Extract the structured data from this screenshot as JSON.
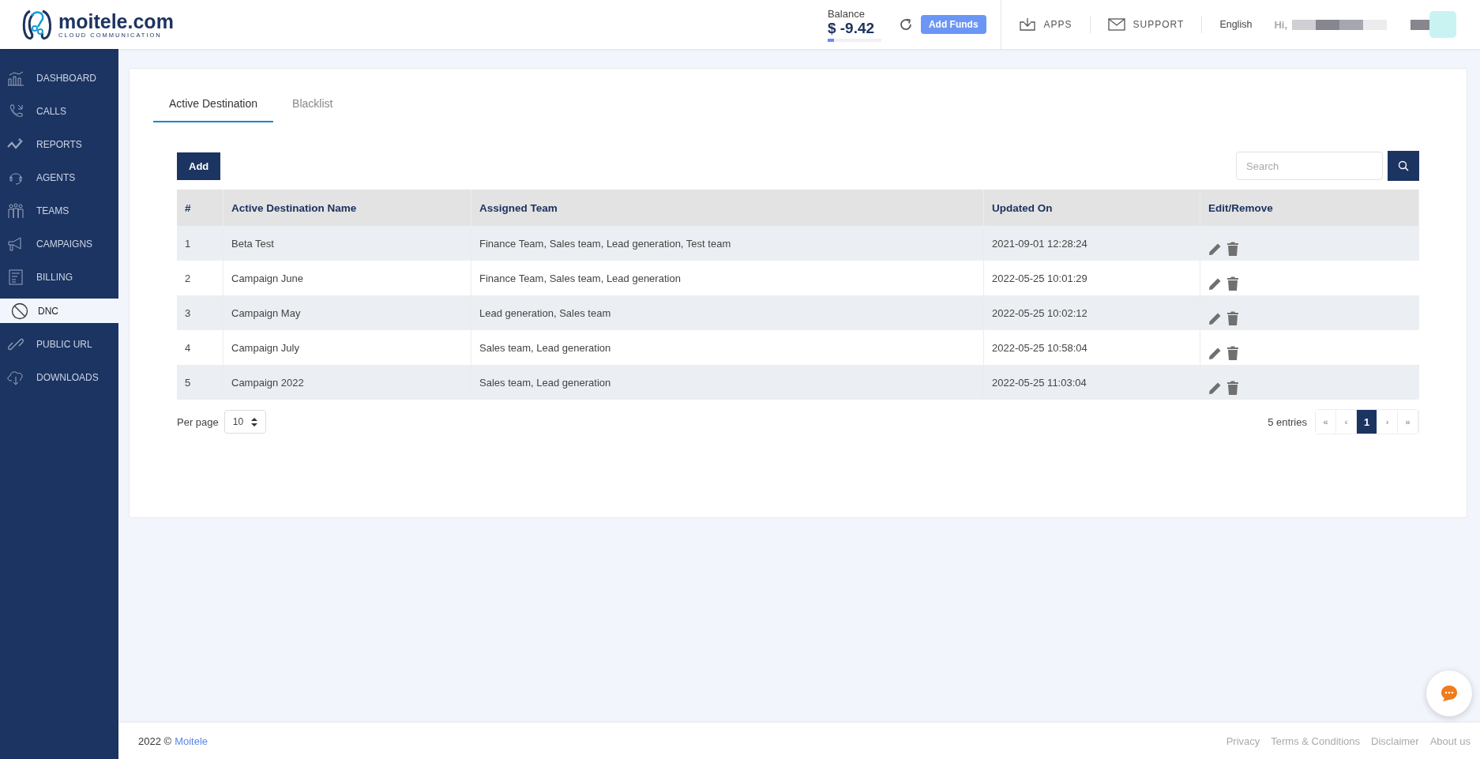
{
  "header": {
    "logo": {
      "name": "moitele.com",
      "tagline": "CLOUD COMMUNICATION"
    },
    "balance": {
      "label": "Balance",
      "amount": "$ -9.42",
      "level": 0.12
    },
    "add_funds": "Add Funds",
    "links": [
      "APPS",
      "SUPPORT"
    ],
    "language": "English",
    "greeting": "Hi,"
  },
  "sidebar": {
    "items": [
      {
        "label": "DASHBOARD",
        "selected": false
      },
      {
        "label": "CALLS",
        "selected": false
      },
      {
        "label": "REPORTS",
        "selected": false
      },
      {
        "label": "AGENTS",
        "selected": false
      },
      {
        "label": "TEAMS",
        "selected": false
      },
      {
        "label": "CAMPAIGNS",
        "selected": false
      },
      {
        "label": "BILLING",
        "selected": false
      },
      {
        "label": "DNC",
        "selected": true
      },
      {
        "label": "PUBLIC URL",
        "selected": false
      },
      {
        "label": "DOWNLOADS",
        "selected": false
      }
    ]
  },
  "tabs": [
    {
      "label": "Active Destination",
      "selected": true
    },
    {
      "label": "Blacklist",
      "selected": false
    }
  ],
  "toolbar": {
    "add": "Add",
    "search": {
      "placeholder": "Search"
    }
  },
  "table": {
    "columns": [
      "#",
      "Active Destination Name",
      "Assigned Team",
      "Updated On",
      "Edit/Remove"
    ],
    "rows": [
      [
        "1",
        "Beta Test",
        "Finance Team, Sales team, Lead generation, Test team",
        "2021-09-01 12:28:24"
      ],
      [
        "2",
        "Campaign June",
        "Finance Team, Sales team, Lead generation",
        "2022-05-25 10:01:29"
      ],
      [
        "3",
        "Campaign May",
        "Lead generation, Sales team",
        "2022-05-25 10:02:12"
      ],
      [
        "4",
        "Campaign July",
        "Sales team, Lead generation",
        "2022-05-25 10:58:04"
      ],
      [
        "5",
        "Campaign 2022",
        "Sales team, Lead generation",
        "2022-05-25 11:03:04"
      ]
    ]
  },
  "per_page": {
    "label": "Per page",
    "value": "10"
  },
  "entries": "5 entries",
  "pagination": [
    {
      "label": "«",
      "selected": false
    },
    {
      "label": "‹",
      "selected": false
    },
    {
      "label": "1",
      "selected": true
    },
    {
      "label": "›",
      "selected": false
    },
    {
      "label": "»",
      "selected": false
    }
  ],
  "footer": {
    "copyright": "2022 ©",
    "brand": "Moitele",
    "links": [
      "Privacy",
      "Terms & Conditions",
      "Disclaimer",
      "About us"
    ]
  }
}
